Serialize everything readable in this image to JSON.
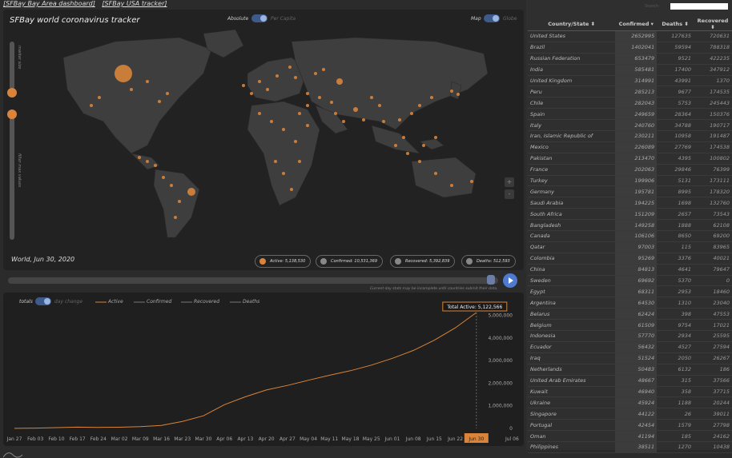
{
  "links": {
    "bay_area": "[SFBay Bay Area dashboard]",
    "usa": "[SFBay USA tracker]"
  },
  "map": {
    "title": "SFBay world coronavirus tracker",
    "toggle_absolute": "Absolute",
    "toggle_percapita": "Per Capita",
    "toggle_map": "Map",
    "toggle_globe": "Globe",
    "slider1_label": "marker size",
    "slider2_label": "filter max values",
    "zoom_in": "+",
    "zoom_out": "-",
    "date_label": "World, Jun 30, 2020",
    "pills": [
      {
        "label": "Active: 5,138,530",
        "color": "#d9843a"
      },
      {
        "label": "Confirmed: 10,531,369",
        "color": "#888888"
      },
      {
        "label": "Recovered: 5,392,839",
        "color": "#888888"
      },
      {
        "label": "Deaths: 512,593",
        "color": "#888888"
      }
    ],
    "note": "Current day stats may be incomplete until countries submit their data."
  },
  "chart_controls": {
    "totals": "totals",
    "daychange": "day change",
    "active": "Active",
    "confirmed": "Confirmed",
    "recovered": "Recovered",
    "deaths": "Deaths"
  },
  "chart_data": {
    "type": "line",
    "title": "",
    "x": [
      "Jan 27",
      "Feb 03",
      "Feb 10",
      "Feb 17",
      "Feb 24",
      "Mar 02",
      "Mar 09",
      "Mar 16",
      "Mar 23",
      "Mar 30",
      "Apr 06",
      "Apr 13",
      "Apr 20",
      "Apr 27",
      "May 04",
      "May 11",
      "May 18",
      "May 25",
      "Jun 01",
      "Jun 08",
      "Jun 15",
      "Jun 22",
      "Jun 30"
    ],
    "series": [
      {
        "name": "Active",
        "values": [
          2000,
          15000,
          35000,
          57000,
          47000,
          52000,
          78000,
          130000,
          310000,
          560000,
          1050000,
          1400000,
          1700000,
          1900000,
          2130000,
          2350000,
          2550000,
          2800000,
          3100000,
          3450000,
          3900000,
          4450000,
          5122566
        ]
      }
    ],
    "yticks": [
      "0",
      "1,000,000",
      "2,000,000",
      "3,000,000",
      "4,000,000",
      "5,000,000"
    ],
    "ylim": [
      0,
      5300000
    ],
    "tooltip": "Total Active: 5,122,566",
    "selected_date": "Jun 30",
    "last_tick_fragment": "Jul 06",
    "line_color": "#d9843a"
  },
  "table": {
    "search_label": "Search:",
    "headers": [
      "Country/State",
      "Confirmed",
      "Deaths",
      "Recovered"
    ],
    "rows": [
      [
        "United States",
        "2652995",
        "127635",
        "720631"
      ],
      [
        "Brazil",
        "1402041",
        "59594",
        "788318"
      ],
      [
        "Russian Federation",
        "653479",
        "9521",
        "422235"
      ],
      [
        "India",
        "585481",
        "17400",
        "347912"
      ],
      [
        "United Kingdom",
        "314991",
        "43991",
        "1370"
      ],
      [
        "Peru",
        "285213",
        "9677",
        "174535"
      ],
      [
        "Chile",
        "282043",
        "5753",
        "245443"
      ],
      [
        "Spain",
        "249659",
        "28364",
        "150376"
      ],
      [
        "Italy",
        "240760",
        "34788",
        "190717"
      ],
      [
        "Iran, Islamic Republic of",
        "230211",
        "10958",
        "191487"
      ],
      [
        "Mexico",
        "226089",
        "27769",
        "174538"
      ],
      [
        "Pakistan",
        "213470",
        "4395",
        "100802"
      ],
      [
        "France",
        "202063",
        "29846",
        "76399"
      ],
      [
        "Turkey",
        "199906",
        "5131",
        "173111"
      ],
      [
        "Germany",
        "195781",
        "8995",
        "178320"
      ],
      [
        "Saudi Arabia",
        "194225",
        "1698",
        "132760"
      ],
      [
        "South Africa",
        "151209",
        "2657",
        "73543"
      ],
      [
        "Bangladesh",
        "149258",
        "1888",
        "62108"
      ],
      [
        "Canada",
        "106106",
        "8650",
        "69200"
      ],
      [
        "Qatar",
        "97003",
        "115",
        "83965"
      ],
      [
        "Colombia",
        "95269",
        "3376",
        "40021"
      ],
      [
        "China",
        "84813",
        "4641",
        "79647"
      ],
      [
        "Sweden",
        "69692",
        "5370",
        "0"
      ],
      [
        "Egypt",
        "68311",
        "2953",
        "18460"
      ],
      [
        "Argentina",
        "64530",
        "1310",
        "23040"
      ],
      [
        "Belarus",
        "62424",
        "398",
        "47553"
      ],
      [
        "Belgium",
        "61509",
        "9754",
        "17021"
      ],
      [
        "Indonesia",
        "57770",
        "2934",
        "25595"
      ],
      [
        "Ecuador",
        "56432",
        "4527",
        "27594"
      ],
      [
        "Iraq",
        "51524",
        "2050",
        "26267"
      ],
      [
        "Netherlands",
        "50483",
        "6132",
        "186"
      ],
      [
        "United Arab Emirates",
        "48667",
        "315",
        "37566"
      ],
      [
        "Kuwait",
        "46940",
        "358",
        "37715"
      ],
      [
        "Ukraine",
        "45924",
        "1188",
        "20244"
      ],
      [
        "Singapore",
        "44122",
        "26",
        "39011"
      ],
      [
        "Portugal",
        "42454",
        "1579",
        "27798"
      ],
      [
        "Oman",
        "41194",
        "185",
        "24162"
      ],
      [
        "Philippines",
        "38511",
        "1270",
        "10438"
      ]
    ]
  }
}
